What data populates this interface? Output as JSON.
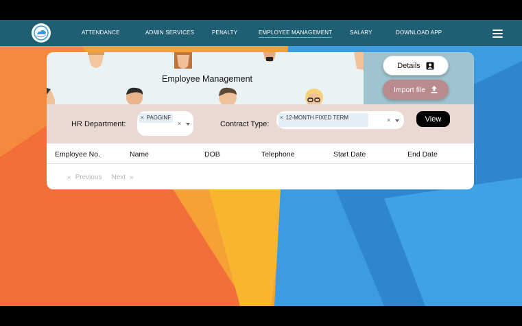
{
  "nav": {
    "items": [
      "ATTENDANCE",
      "ADMIN SERVICES",
      "PENALTY",
      "EMPLOYEE MANAGEMENT",
      "SALARY",
      "DOWNLOAD APP"
    ],
    "active": "EMPLOYEE MANAGEMENT",
    "bar_color": "#1f5e73"
  },
  "header": {
    "title": "Employee Management",
    "details_label": "Details",
    "import_label": "Import file"
  },
  "filters": {
    "hr_label": "HR Department:",
    "hr_value": "PAGGINF",
    "contract_label": "Contract Type:",
    "contract_value": "12-MONTH FIXED TERM",
    "chip_remove": "×",
    "clear": "×",
    "view_label": "View"
  },
  "table": {
    "columns": [
      "Employee No.",
      "Name",
      "DOB",
      "Telephone",
      "Start Date",
      "End Date"
    ],
    "rows": []
  },
  "pager": {
    "prev_arrow": "«",
    "prev": "Previous",
    "next": "Next",
    "next_arrow": "»"
  },
  "colors": {
    "header_bg": "#eaf3f3",
    "header_right_bg": "#9ec5cf",
    "filter_bg": "#ead8d2",
    "import_btn": "#b98b8d",
    "orange": "#f57c3a",
    "blue": "#3b95d6"
  }
}
